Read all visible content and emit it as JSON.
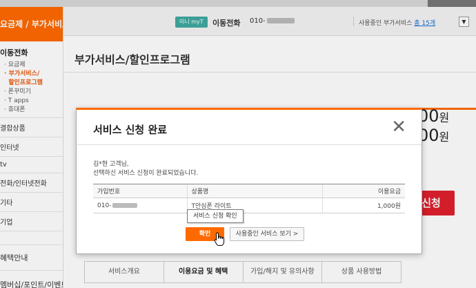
{
  "sidebar": {
    "header": "요금제 / 부가서비스",
    "section_title": "이동전화",
    "subitems": [
      {
        "label": "요금제",
        "active": false
      },
      {
        "label": "부가서비스/",
        "active": true
      },
      {
        "label": "할인프로그램",
        "active": true
      },
      {
        "label": "폰꾸미기",
        "active": false
      },
      {
        "label": "T apps",
        "active": false
      },
      {
        "label": "휴대폰",
        "active": false
      }
    ],
    "items": [
      "결합상품",
      "인터넷",
      "tv",
      "전화/인터넷전화",
      "기타",
      "기업"
    ],
    "bottom_items": [
      "혜택안내",
      "멤버십/포인트/이벤트"
    ]
  },
  "header": {
    "badge": "미니 myT",
    "line_label": "이동전화",
    "phone_prefix": "010-",
    "inuse_label": "사용중인 부가서비스",
    "inuse_count": "총 15개",
    "dropdown_icon": "chevron-down-icon"
  },
  "page": {
    "title": "부가서비스/할인프로그램",
    "price1": "00",
    "price1_unit": "원",
    "price2": "00",
    "price2_unit": "원",
    "apply_button": "신청"
  },
  "tabs": [
    {
      "label": "서비스개요",
      "active": false
    },
    {
      "label": "이용요금 및 혜택",
      "active": true
    },
    {
      "label": "가입/해지 및 유의사항",
      "active": false
    },
    {
      "label": "상품 사용방법",
      "active": false
    }
  ],
  "modal": {
    "title": "서비스 신청 완료",
    "close_icon": "close-icon",
    "greeting_line1": "김*현 고객님,",
    "greeting_line2": "선택하신 서비스 신청이 완료되었습니다.",
    "table": {
      "headers": [
        "가입번호",
        "상품명",
        "이용요금"
      ],
      "row": {
        "number_prefix": "010-",
        "product": "T안심폰 라이트",
        "fee": "1,000원"
      }
    },
    "tooltip": "서비스 신청 확인",
    "ok_button": "확인",
    "view_button": "사용중인 서비스 보기 >"
  },
  "colors": {
    "accent": "#ff6a00",
    "apply_red": "#e0202e",
    "badge_teal": "#3fa9a1",
    "link_blue": "#1a6fcf"
  }
}
